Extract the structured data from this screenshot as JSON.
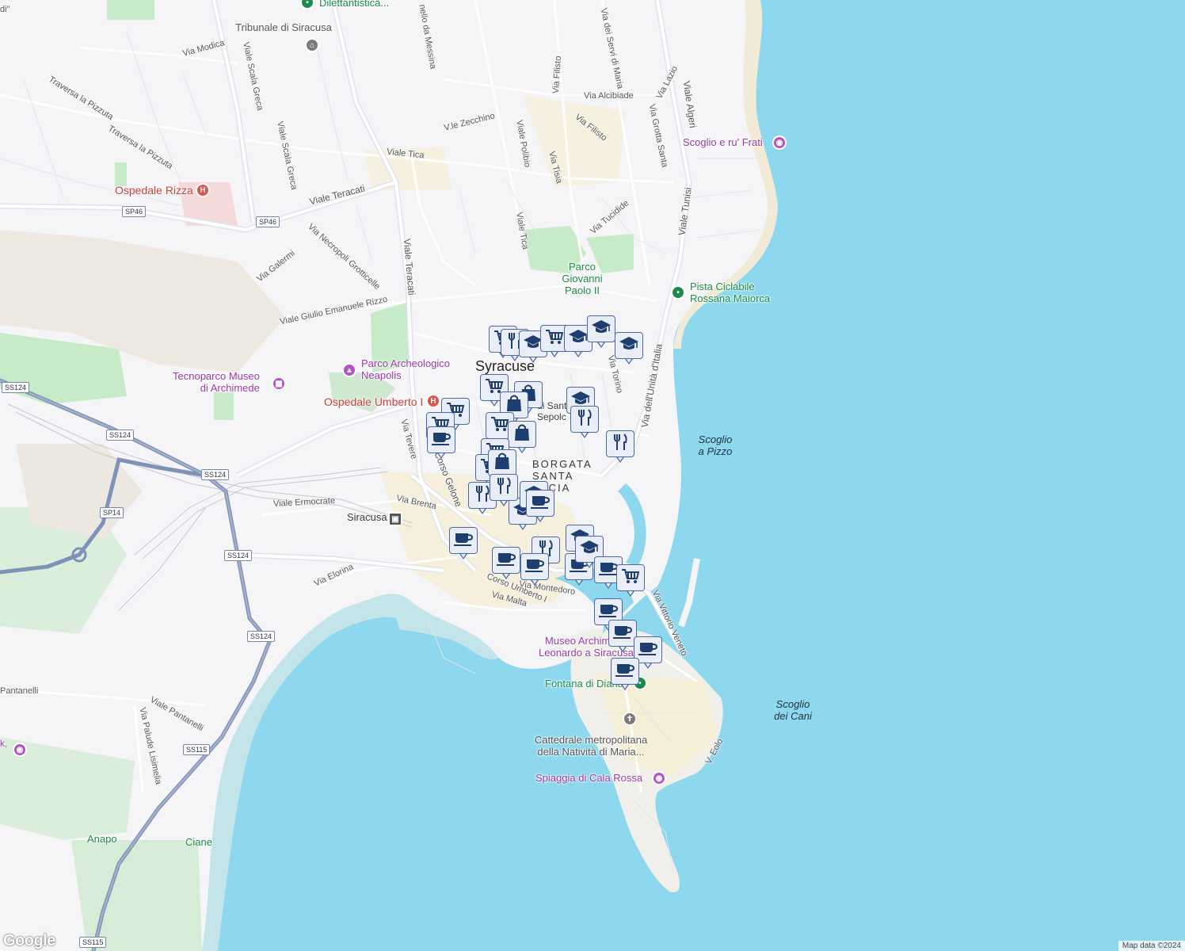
{
  "attribution": "Map data ©2024",
  "logo": "Google",
  "city_label": "Syracuse",
  "district_label": "BORGATA SANTA LUCIA",
  "sea_labels": [
    {
      "text": "Scoglio\na Pizzo",
      "id": "scoglio-a-pizzo"
    },
    {
      "text": "Scoglio\ndei Cani",
      "id": "scoglio-dei-cani"
    }
  ],
  "pois": [
    {
      "text": "Dilettantistica...",
      "color": "green",
      "icon": "pin-icon"
    },
    {
      "text": "Tribunale di Siracusa",
      "color": "grey",
      "icon": "courthouse-icon"
    },
    {
      "text": "Ospedale Rizza",
      "color": "red",
      "icon": "hospital-icon"
    },
    {
      "text": "Scoglio e ru' Frati",
      "color": "purple",
      "icon": "camera-icon"
    },
    {
      "text": "Parco\nGiovanni\nPaolo II",
      "color": "green",
      "icon": ""
    },
    {
      "text": "Pista Ciclabile\nRossana Maiorca",
      "color": "green",
      "icon": "pin-icon"
    },
    {
      "text": "Parco Archeologico\nNeapolis",
      "color": "purple",
      "icon": "monument-icon"
    },
    {
      "text": "Tecnoparco Museo\ndi Archimede",
      "color": "purple",
      "icon": "museum-icon"
    },
    {
      "text": "Ospedale Umberto I",
      "color": "red",
      "icon": "hospital-icon"
    },
    {
      "text": "Siracusa",
      "color": "dark",
      "icon": "train-icon"
    },
    {
      "text": "Museo Archimede\nLeonardo a Siracusa",
      "color": "purple",
      "icon": "museum-icon"
    },
    {
      "text": "Fontana di Diana",
      "color": "green",
      "icon": "pin-icon"
    },
    {
      "text": "Cattedrale metropolitana\ndella Natività di Maria...",
      "color": "grey",
      "icon": "church-icon"
    },
    {
      "text": "Spiaggia di Cala Rossa",
      "color": "purple",
      "icon": "camera-icon"
    },
    {
      "text": "Anapo",
      "color": "green",
      "icon": ""
    },
    {
      "text": "Ciane",
      "color": "green",
      "icon": ""
    },
    {
      "text": "di Sant Sepolc",
      "color": "dark",
      "icon": ""
    }
  ],
  "streets": [
    "Via Modica",
    "Viale Scala Greca",
    "Viale Scala Greca",
    "Traversa la Pizzuta",
    "Traversa la Pizzuta",
    "Viale Teracati",
    "Viale Teracati",
    "Viale Tica",
    "Viale Tica",
    "V.le Zecchino",
    "Viale Polibio",
    "Via Tisia",
    "Via Filisto",
    "Via Filisto",
    "Via dei Servi di Maria",
    "Via Alcibiade",
    "Via Lazio",
    "Via Grotta Santa",
    "Viale Algeri",
    "Viale Tunisi",
    "Via Tucidide",
    "Via Necropoli Grotticelle",
    "Via Galermi",
    "Viale Giulio Emanuele Rizzo",
    "Via Torino",
    "Via dell'Unità d'Italia",
    "Via Tevere",
    "Corso Gelone",
    "Via Brenta",
    "Viale Ermocrate",
    "Via Elorina",
    "Corso Umberto I",
    "Via Malta",
    "Via Vittorio Veneto",
    "Viale Pantanelli",
    "Via Palude Lisimelia",
    "V. Eolo",
    "Pantanelli",
    "Via Montedoro",
    "nello da Messina",
    "di\""
  ],
  "road_shields": [
    "SP46",
    "SP46",
    "SS124",
    "SS124",
    "SS124",
    "SS124",
    "SP14",
    "SS124",
    "SS115",
    "SS115"
  ],
  "markers": [
    {
      "type": "shopping-cart-icon"
    },
    {
      "type": "restaurant-icon"
    },
    {
      "type": "school-icon"
    },
    {
      "type": "shopping-cart-icon"
    },
    {
      "type": "school-icon"
    },
    {
      "type": "school-icon"
    },
    {
      "type": "school-icon"
    },
    {
      "type": "shopping-cart-icon"
    },
    {
      "type": "shopping-bag-icon"
    },
    {
      "type": "shopping-bag-icon"
    },
    {
      "type": "school-icon"
    },
    {
      "type": "restaurant-icon"
    },
    {
      "type": "restaurant-icon"
    },
    {
      "type": "shopping-cart-icon"
    },
    {
      "type": "shopping-cart-icon"
    },
    {
      "type": "shopping-cart-icon"
    },
    {
      "type": "shopping-bag-icon"
    },
    {
      "type": "coffee-icon"
    },
    {
      "type": "shopping-cart-icon"
    },
    {
      "type": "shopping-cart-icon"
    },
    {
      "type": "shopping-bag-icon"
    },
    {
      "type": "restaurant-icon"
    },
    {
      "type": "school-icon"
    },
    {
      "type": "restaurant-icon"
    },
    {
      "type": "coffee-icon"
    },
    {
      "type": "school-icon"
    },
    {
      "type": "coffee-icon"
    },
    {
      "type": "coffee-icon"
    },
    {
      "type": "coffee-icon"
    },
    {
      "type": "restaurant-icon"
    },
    {
      "type": "school-icon"
    },
    {
      "type": "school-icon"
    },
    {
      "type": "coffee-icon"
    },
    {
      "type": "coffee-icon"
    },
    {
      "type": "shopping-cart-icon"
    },
    {
      "type": "coffee-icon"
    },
    {
      "type": "coffee-icon"
    },
    {
      "type": "coffee-icon"
    },
    {
      "type": "coffee-icon"
    }
  ],
  "colors": {
    "sea": "#8dd8ee",
    "land": "#f5f4f6",
    "park": "#c7ebc9",
    "highway": "#7f92b8",
    "marker_border": "#4a6aa6",
    "marker_fill": "#e9edf6",
    "marker_icon": "#1f3e70",
    "purple_poi": "#9a3aa8",
    "red_poi": "#c8403a",
    "green_poi": "#1b8a4a"
  }
}
